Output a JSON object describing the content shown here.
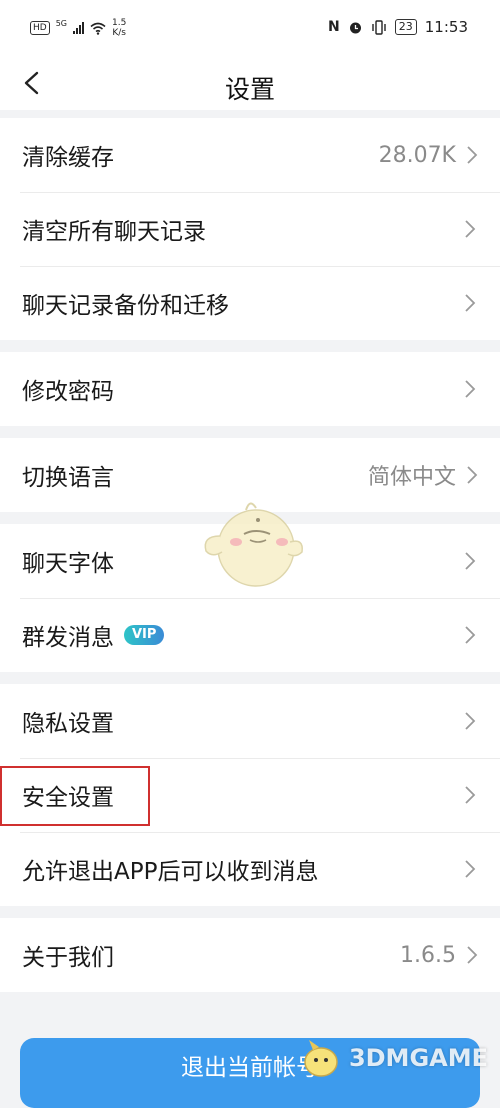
{
  "status_bar": {
    "hd": "HD",
    "network": "5G",
    "speed_value": "1.5",
    "speed_unit": "K/s",
    "nfc": "N",
    "battery": "23",
    "time": "11:53"
  },
  "header": {
    "title": "设置",
    "back_icon": "chevron-left-icon"
  },
  "groups": [
    [
      {
        "label": "清除缓存",
        "value": "28.07K"
      },
      {
        "label": "清空所有聊天记录"
      },
      {
        "label": "聊天记录备份和迁移"
      }
    ],
    [
      {
        "label": "修改密码"
      }
    ],
    [
      {
        "label": "切换语言",
        "value": "简体中文"
      }
    ],
    [
      {
        "label": "聊天字体"
      },
      {
        "label": "群发消息",
        "badge": "VIP"
      }
    ],
    [
      {
        "label": "隐私设置"
      },
      {
        "label": "安全设置"
      },
      {
        "label": "允许退出APP后可以收到消息"
      }
    ],
    [
      {
        "label": "关于我们",
        "value": "1.6.5"
      }
    ]
  ],
  "logout_button": "退出当前帐号",
  "watermark": "3DMGAME",
  "colors": {
    "accent": "#3d9bed",
    "highlight": "#d0302f",
    "background": "#f2f3f5"
  }
}
